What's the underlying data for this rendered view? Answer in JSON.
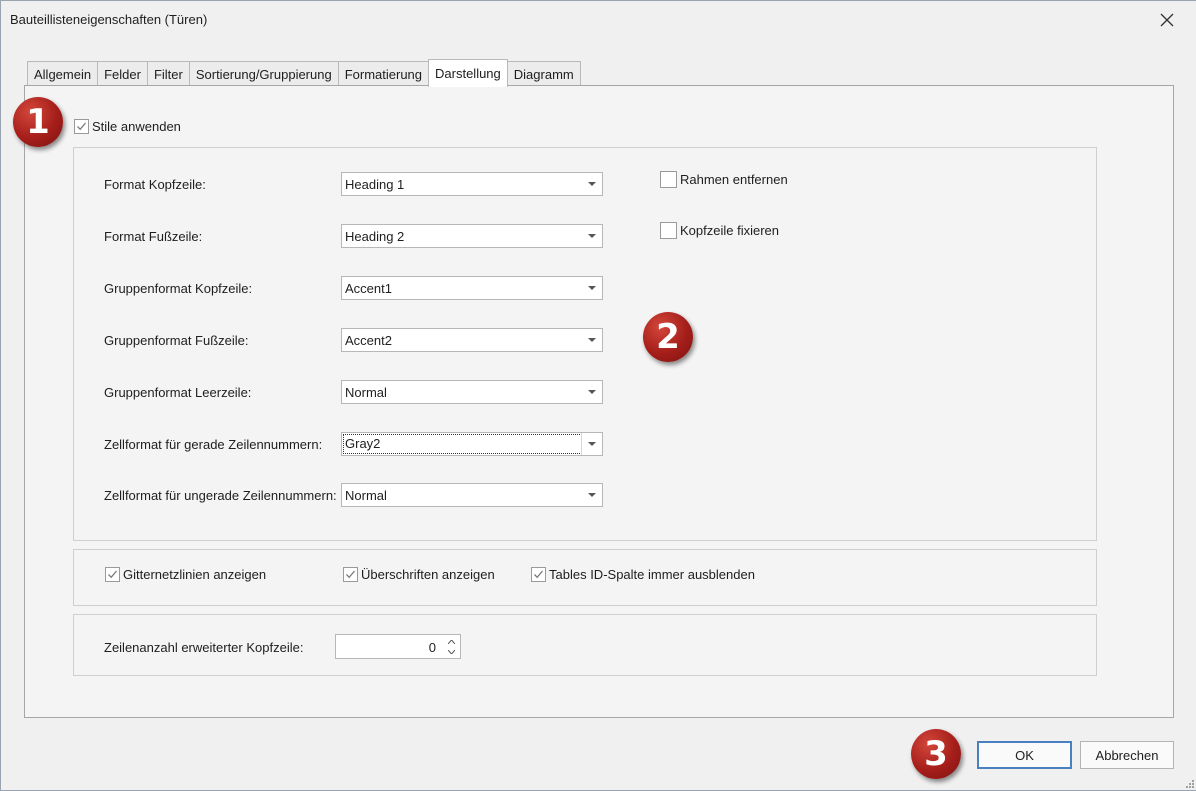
{
  "window": {
    "title": "Bauteillisteneigenschaften (Türen)"
  },
  "tabs": [
    {
      "label": "Allgemein"
    },
    {
      "label": "Felder"
    },
    {
      "label": "Filter"
    },
    {
      "label": "Sortierung/Gruppierung"
    },
    {
      "label": "Formatierung"
    },
    {
      "label": "Darstellung",
      "active": true
    },
    {
      "label": "Diagramm"
    }
  ],
  "badges": {
    "one": "1",
    "two": "2",
    "three": "3"
  },
  "apply_styles": {
    "label": "Stile anwenden",
    "checked": true
  },
  "formats": {
    "rows": [
      {
        "label": "Format Kopfzeile:",
        "value": "Heading 1"
      },
      {
        "label": "Format Fußzeile:",
        "value": "Heading 2"
      },
      {
        "label": "Gruppenformat Kopfzeile:",
        "value": "Accent1"
      },
      {
        "label": "Gruppenformat Fußzeile:",
        "value": "Accent2"
      },
      {
        "label": "Gruppenformat Leerzeile:",
        "value": "Normal"
      },
      {
        "label": "Zellformat für gerade Zeilennummern:",
        "value": "Gray2"
      },
      {
        "label": "Zellformat für ungerade Zeilennummern:",
        "value": "Normal"
      }
    ],
    "remove_border": {
      "label": "Rahmen entfernen",
      "checked": false
    },
    "freeze_header": {
      "label": "Kopfzeile fixieren",
      "checked": false
    }
  },
  "display_options": {
    "gridlines": {
      "label": "Gitternetzlinien anzeigen",
      "checked": true
    },
    "headings": {
      "label": "Überschriften anzeigen",
      "checked": true
    },
    "hide_id": {
      "label": "Tables ID-Spalte immer ausblenden",
      "checked": true
    }
  },
  "extended_header": {
    "label": "Zeilenanzahl erweiterter Kopfzeile:",
    "value": "0"
  },
  "buttons": {
    "ok": "OK",
    "cancel": "Abbrechen"
  },
  "colors": {
    "badge_red": "#a51e1a",
    "default_button_border": "#4a7fc1"
  },
  "icons": {
    "close": "close-icon",
    "check": "checkmark-icon",
    "dropdown": "chevron-down-icon",
    "spin_up": "spin-up-icon",
    "spin_down": "spin-down-icon"
  }
}
